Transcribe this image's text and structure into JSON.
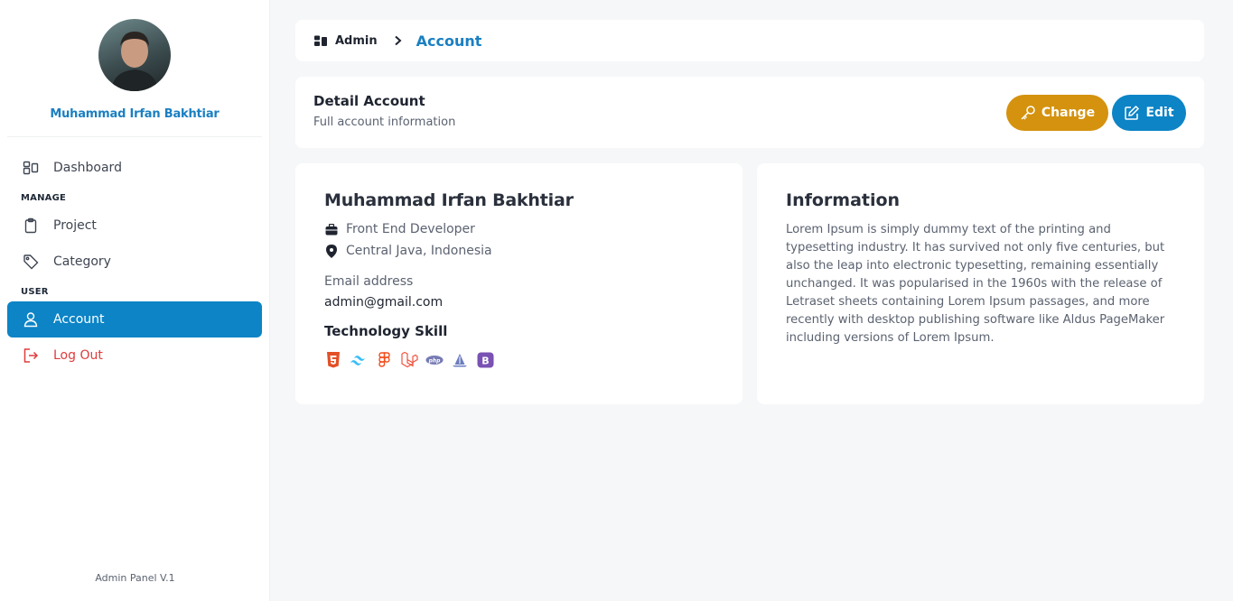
{
  "sidebar": {
    "profile_name": "Muhammad Irfan Bakhtiar",
    "items": [
      {
        "label": "Dashboard",
        "icon": "dashboard-icon"
      },
      {
        "label": "Project",
        "icon": "clipboard-icon"
      },
      {
        "label": "Category",
        "icon": "tag-icon"
      },
      {
        "label": "Account",
        "icon": "user-icon"
      },
      {
        "label": "Log Out",
        "icon": "logout-icon"
      }
    ],
    "section_manage": "MANAGE",
    "section_user": "USER",
    "footer": "Admin Panel V.1"
  },
  "breadcrumb": {
    "root": "Admin",
    "current": "Account"
  },
  "detail": {
    "title": "Detail Account",
    "subtitle": "Full account information",
    "change_label": "Change",
    "edit_label": "Edit"
  },
  "profile": {
    "name": "Muhammad Irfan Bakhtiar",
    "role": "Front End Developer",
    "location": "Central Java, Indonesia",
    "email_label": "Email address",
    "email": "admin@gmail.com",
    "skills_title": "Technology Skill",
    "skills": [
      "html5-icon",
      "tailwind-icon",
      "figma-icon",
      "laravel-icon",
      "php-icon",
      "alpine-icon",
      "bootstrap-icon"
    ]
  },
  "information": {
    "title": "Information",
    "text": "Lorem Ipsum is simply dummy text of the printing and typesetting industry. It has survived not only five centuries, but also the leap into electronic typesetting, remaining essentially unchanged. It was popularised in the 1960s with the release of Letraset sheets containing Lorem Ipsum passages, and more recently with desktop publishing software like Aldus PageMaker including versions of Lorem Ipsum."
  },
  "colors": {
    "primary": "#0c84c6",
    "change_button": "#d4920f",
    "logout": "#e03b3b",
    "background": "#f6f7f9"
  }
}
